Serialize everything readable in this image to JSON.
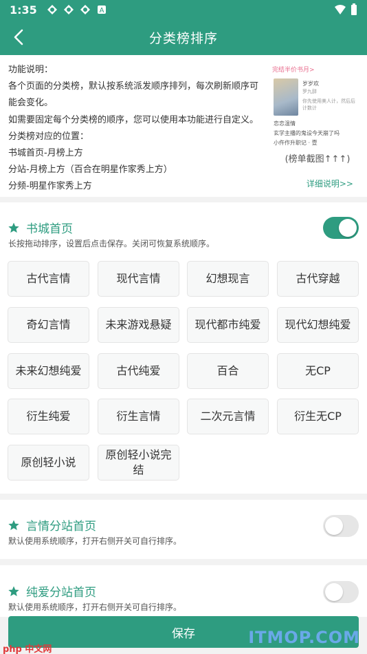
{
  "status_bar": {
    "time": "1:35",
    "app_icon_letter": "A"
  },
  "app_bar": {
    "title": "分类榜排序"
  },
  "intro": {
    "lines": [
      "功能说明：",
      "各个页面的分类榜，默认按系统派发顺序排列，每次刷新顺序可",
      "能会变化。",
      "如需要固定每个分类榜的顺序，您可以使用本功能进行自定义。",
      "分类榜对应的位置：",
      "书城首页-月榜上方",
      "分站-月榜上方（百合在明星作家秀上方）",
      "分频-明星作家秀上方"
    ],
    "thumbnail": {
      "header": "完结半价书月>",
      "book_title": "岁岁欢",
      "book_author": "罗九辞",
      "book_blurb": "你先使用美人计，然后后计数计",
      "list_line_1": "恋恋温情",
      "list_line_2": "玄学主播的鬼设今天崩了吗",
      "list_line_3": "小仵作升职记 · 壹"
    },
    "caption": "(榜单截图↑↑↑)",
    "detail_link": "详细说明>>"
  },
  "sections": [
    {
      "title": "书城首页",
      "description": "长按拖动排序，设置后点击保存。关闭可恢复系统顺序。",
      "enabled": true,
      "chips": [
        "古代言情",
        "现代言情",
        "幻想现言",
        "古代穿越",
        "奇幻言情",
        "未来游戏悬疑",
        "现代都市纯爱",
        "现代幻想纯爱",
        "未来幻想纯爱",
        "古代纯爱",
        "百合",
        "无CP",
        "衍生纯爱",
        "衍生言情",
        "二次元言情",
        "衍生无CP",
        "原创轻小说",
        "原创轻小说完结"
      ]
    },
    {
      "title": "言情分站首页",
      "description": "默认使用系统顺序，打开右侧开关可自行排序。",
      "enabled": false
    },
    {
      "title": "纯爱分站首页",
      "description": "默认使用系统顺序，打开右侧开关可自行排序。",
      "enabled": false
    }
  ],
  "save_button": {
    "label": "保存"
  },
  "watermarks": {
    "left": "php 中文网",
    "right": "ITMOP.COM"
  },
  "colors": {
    "primary": "#2e9c80",
    "background": "#f2f2f2",
    "chip_bg": "#f7f8f8",
    "toggle_off": "#e6e6e6"
  }
}
